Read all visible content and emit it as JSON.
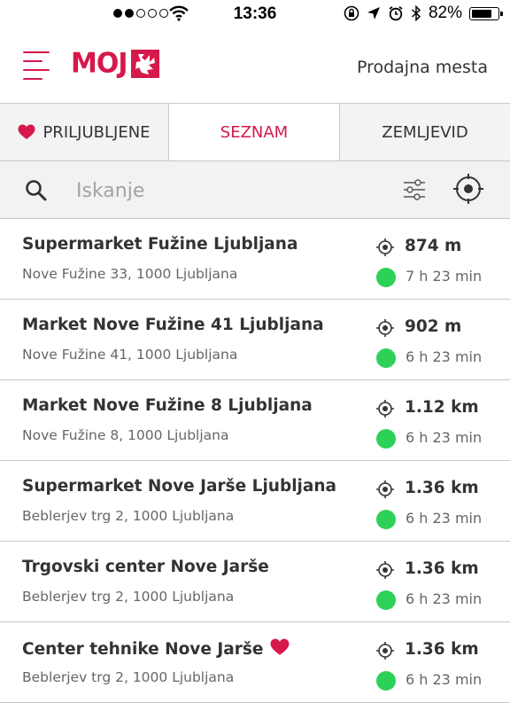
{
  "status_bar": {
    "time": "13:36",
    "battery_percent": "82%",
    "battery_level": 0.82,
    "signal_filled": 2,
    "signal_total": 5
  },
  "header": {
    "logo_text": "MOJ",
    "title": "Prodajna mesta"
  },
  "tabs": [
    {
      "label": "PRILJUBLJENE",
      "active": false
    },
    {
      "label": "SEZNAM",
      "active": true
    },
    {
      "label": "ZEMLJEVID",
      "active": false
    }
  ],
  "search": {
    "placeholder": "Iskanje",
    "value": ""
  },
  "colors": {
    "accent": "#d6184b",
    "open_status": "#2ed158"
  },
  "stores": [
    {
      "name": "Supermarket Fužine Ljubljana",
      "address": "Nove Fužine 33, 1000 Ljubljana",
      "distance": "874 m",
      "time": "7 h 23 min",
      "favorite": false
    },
    {
      "name": "Market Nove Fužine 41 Ljubljana",
      "address": "Nove Fužine 41, 1000 Ljubljana",
      "distance": "902 m",
      "time": "6 h 23 min",
      "favorite": false
    },
    {
      "name": "Market Nove Fužine 8 Ljubljana",
      "address": "Nove Fužine 8, 1000 Ljubljana",
      "distance": "1.12 km",
      "time": "6 h 23 min",
      "favorite": false
    },
    {
      "name": "Supermarket Nove Jarše Ljubljana",
      "address": "Beblerjev trg 2, 1000 Ljubljana",
      "distance": "1.36 km",
      "time": "6 h 23 min",
      "favorite": false
    },
    {
      "name": "Trgovski center Nove Jarše",
      "address": "Beblerjev trg 2, 1000 Ljubljana",
      "distance": "1.36 km",
      "time": "6 h 23 min",
      "favorite": false
    },
    {
      "name": "Center tehnike Nove Jarše",
      "address": "Beblerjev trg 2, 1000 Ljubljana",
      "distance": "1.36 km",
      "time": "6 h 23 min",
      "favorite": true
    }
  ]
}
